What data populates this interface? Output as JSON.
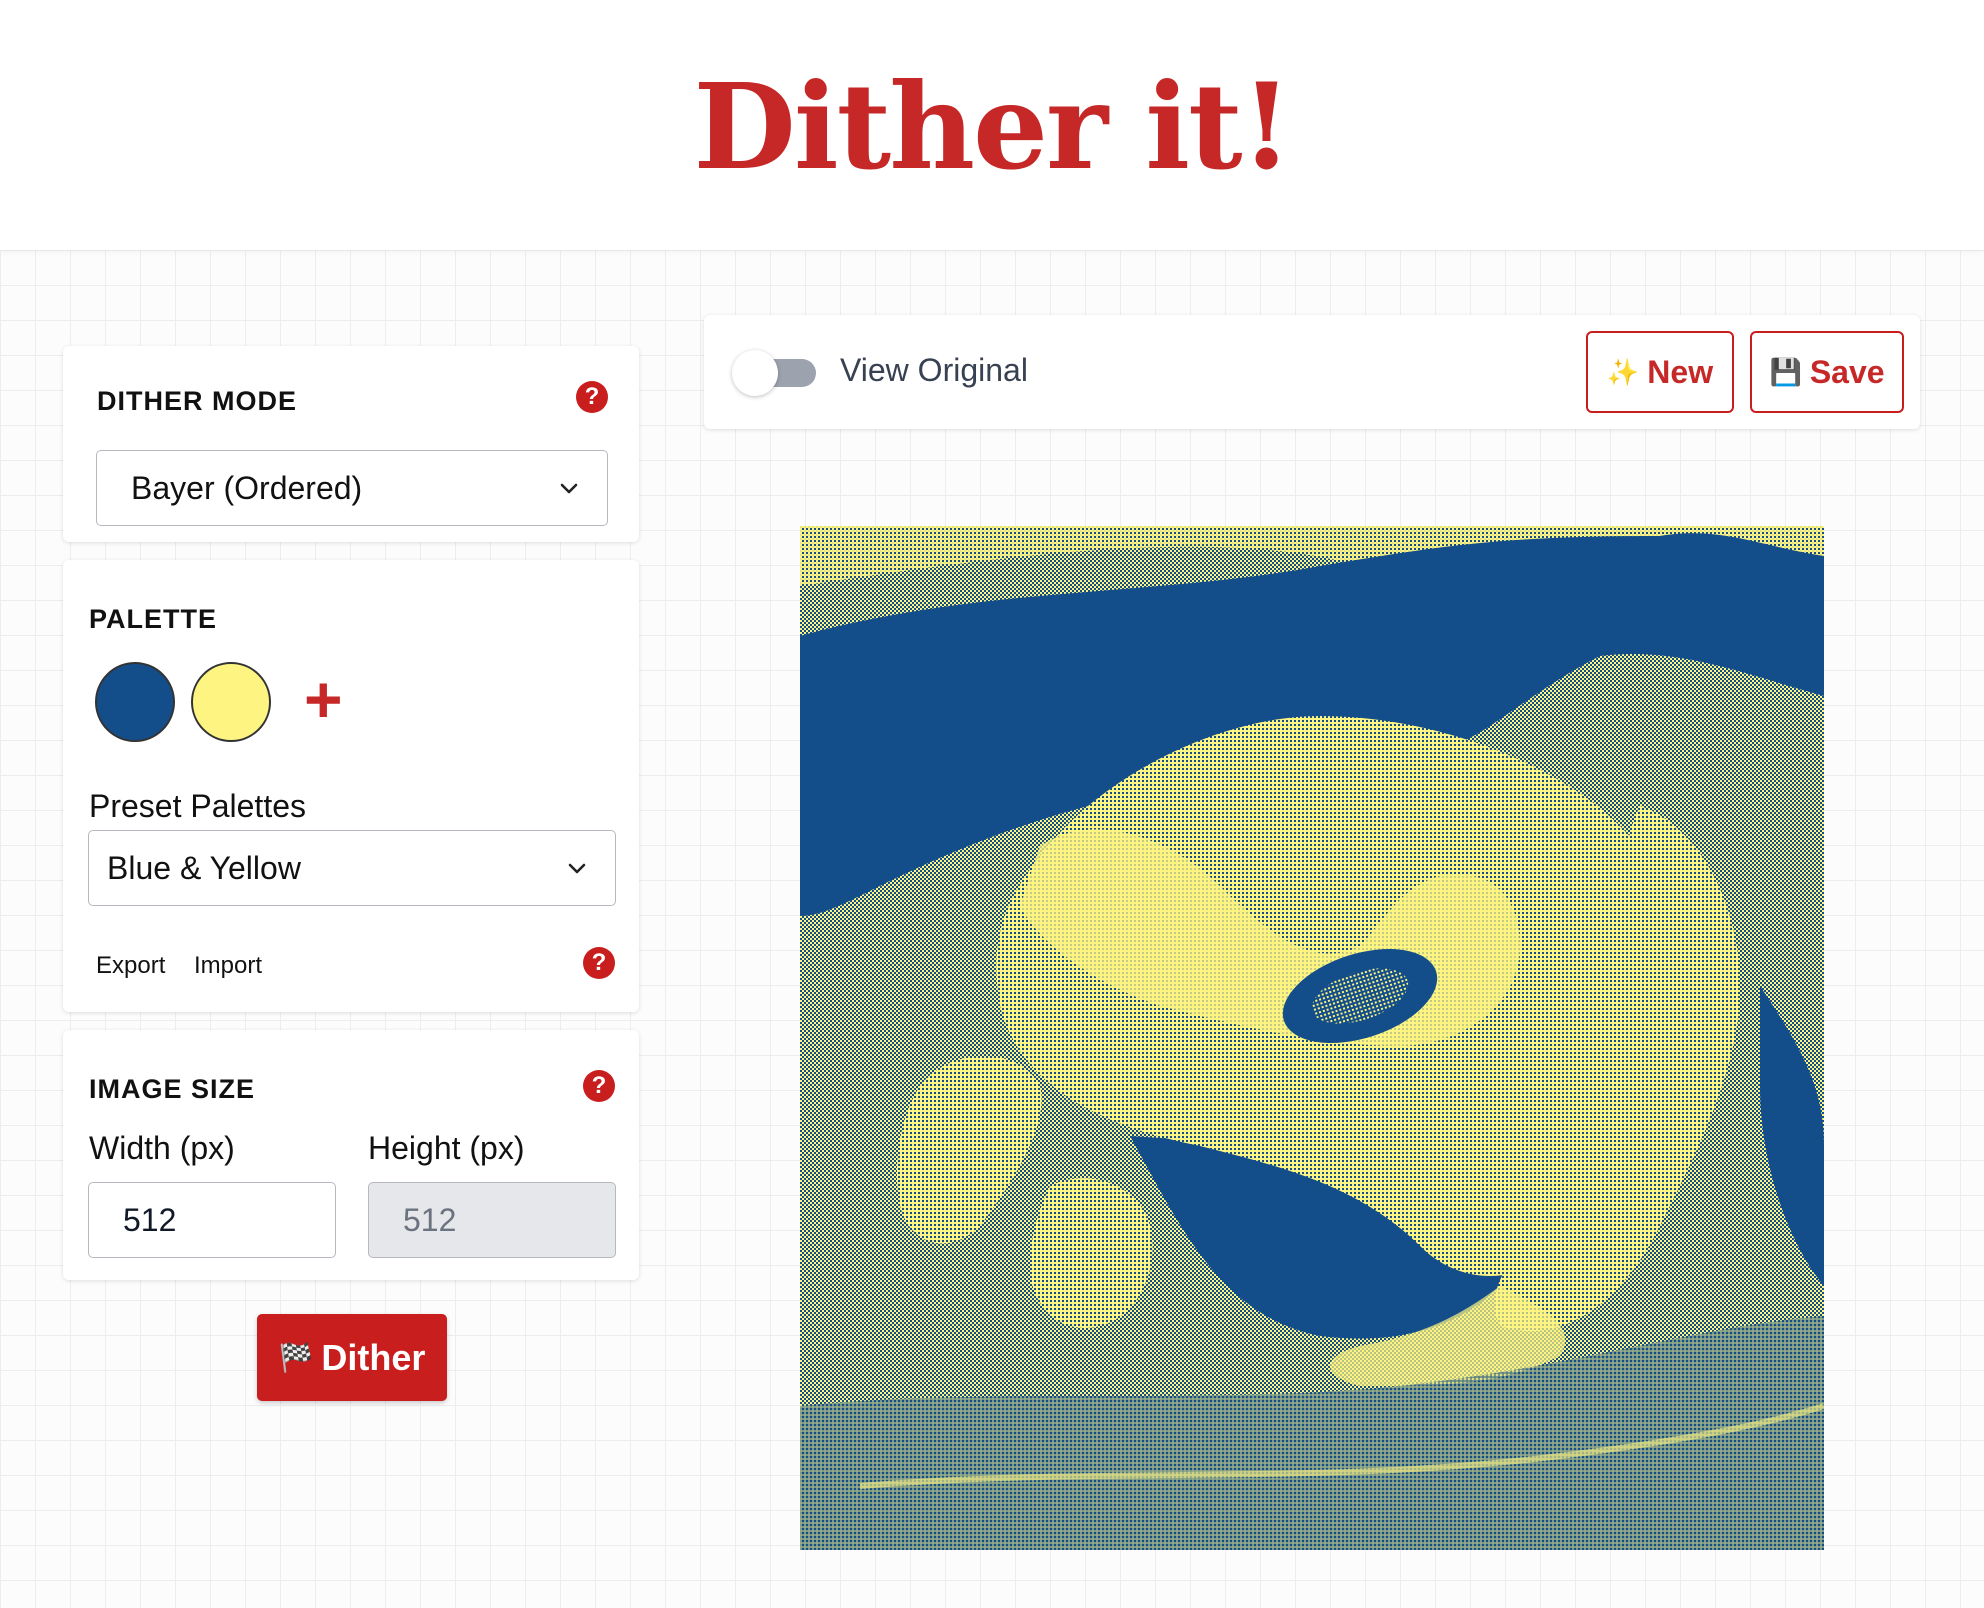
{
  "app": {
    "title": "Dither it!"
  },
  "colors": {
    "brand": "#c62828",
    "palette_blue": "#134e8a",
    "palette_yellow": "#fdf482"
  },
  "dither_mode": {
    "label": "DITHER MODE",
    "selected": "Bayer (Ordered)"
  },
  "palette": {
    "label": "PALETTE",
    "swatches": [
      "#134e8a",
      "#fdf482"
    ],
    "add_label": "+",
    "preset_label": "Preset Palettes",
    "preset_selected": "Blue & Yellow",
    "export_label": "Export",
    "import_label": "Import"
  },
  "image_size": {
    "label": "IMAGE SIZE",
    "width_label": "Width (px)",
    "height_label": "Height (px)",
    "width_value": "512",
    "height_value": "512"
  },
  "help_label": "?",
  "dither_button": {
    "icon": "🏁",
    "label": "Dither"
  },
  "toolbar": {
    "view_original_label": "View Original",
    "view_original_on": false,
    "new_icon": "✨",
    "new_label": "New",
    "save_icon": "💾",
    "save_label": "Save"
  }
}
